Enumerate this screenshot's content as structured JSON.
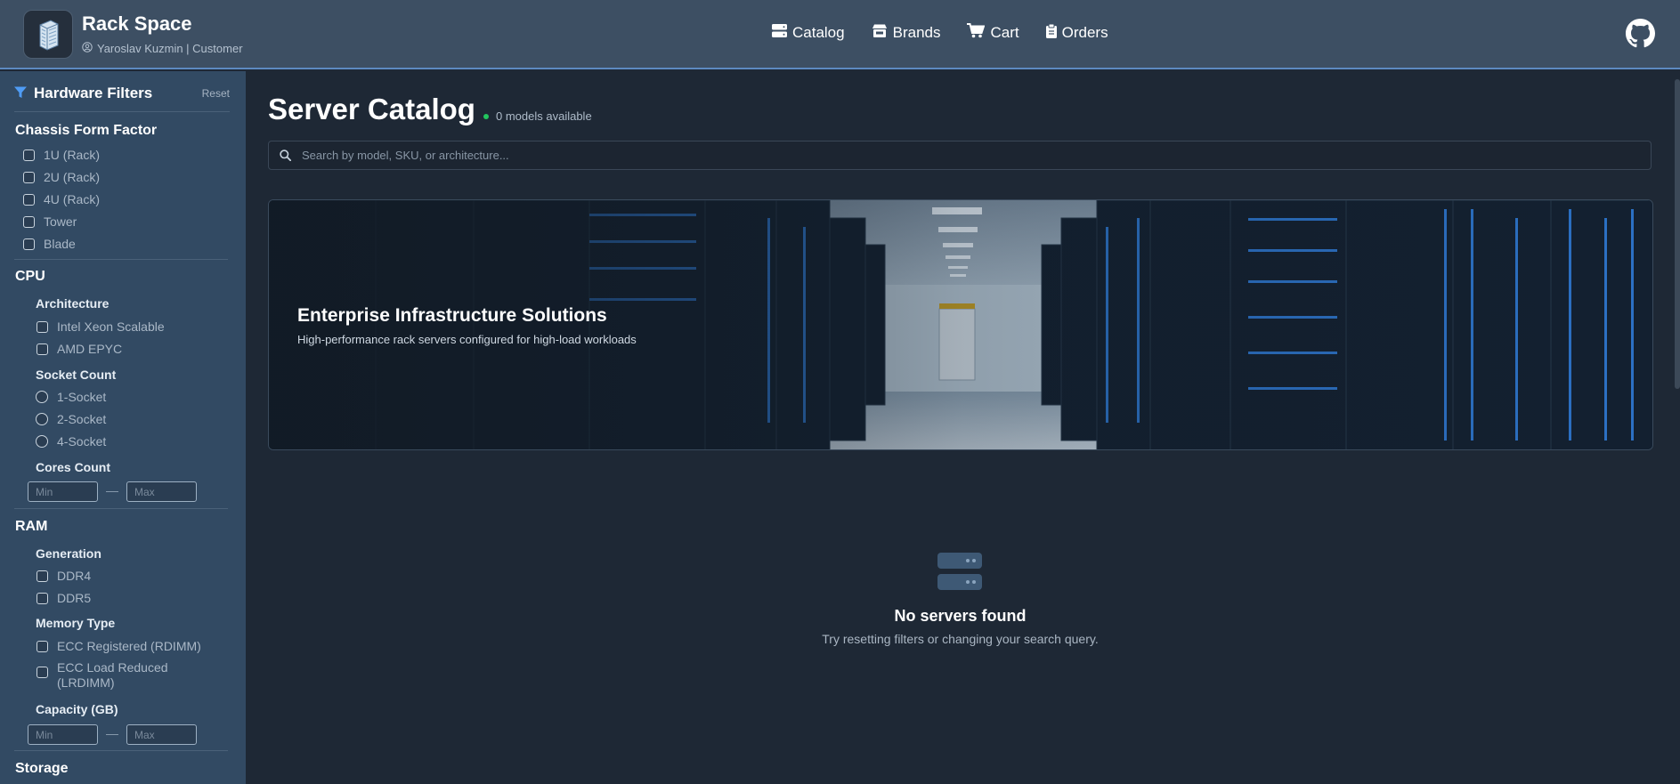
{
  "header": {
    "app_title": "Rack Space",
    "user_line": "Yaroslav Kuzmin | Customer",
    "nav": [
      {
        "label": "Catalog",
        "icon": "server-icon"
      },
      {
        "label": "Brands",
        "icon": "store-icon"
      },
      {
        "label": "Cart",
        "icon": "cart-icon"
      },
      {
        "label": "Orders",
        "icon": "clipboard-icon"
      }
    ],
    "github_icon": "github-icon"
  },
  "sidebar": {
    "title": "Hardware Filters",
    "reset_label": "Reset",
    "chassis": {
      "title": "Chassis Form Factor",
      "options": [
        "1U (Rack)",
        "2U (Rack)",
        "4U (Rack)",
        "Tower",
        "Blade"
      ]
    },
    "cpu": {
      "title": "CPU",
      "architecture_title": "Architecture",
      "architecture_options": [
        "Intel Xeon Scalable",
        "AMD EPYC"
      ],
      "socket_title": "Socket Count",
      "socket_options": [
        "1-Socket",
        "2-Socket",
        "4-Socket"
      ],
      "cores_title": "Cores Count",
      "cores_min_placeholder": "Min",
      "cores_max_placeholder": "Max"
    },
    "ram": {
      "title": "RAM",
      "generation_title": "Generation",
      "generation_options": [
        "DDR4",
        "DDR5"
      ],
      "memory_type_title": "Memory Type",
      "memory_type_options": [
        "ECC Registered (RDIMM)",
        "ECC Load Reduced (LRDIMM)"
      ],
      "capacity_title": "Capacity (GB)",
      "capacity_min_placeholder": "Min",
      "capacity_max_placeholder": "Max"
    },
    "storage": {
      "title": "Storage"
    }
  },
  "main": {
    "title": "Server Catalog",
    "models_count": "0 models available",
    "search_placeholder": "Search by model, SKU, or architecture...",
    "hero": {
      "title": "Enterprise Infrastructure Solutions",
      "subtitle": "High-performance rack servers configured for high-load workloads"
    },
    "empty_state": {
      "icon": "server-icon",
      "title": "No servers found",
      "subtitle": "Try resetting filters or changing your search query."
    }
  },
  "colors": {
    "header_bg": "#3d4f63",
    "sidebar_bg": "#324a63",
    "main_bg": "#1e2835",
    "accent": "#5d8ac1",
    "status_dot": "#22c55e"
  }
}
